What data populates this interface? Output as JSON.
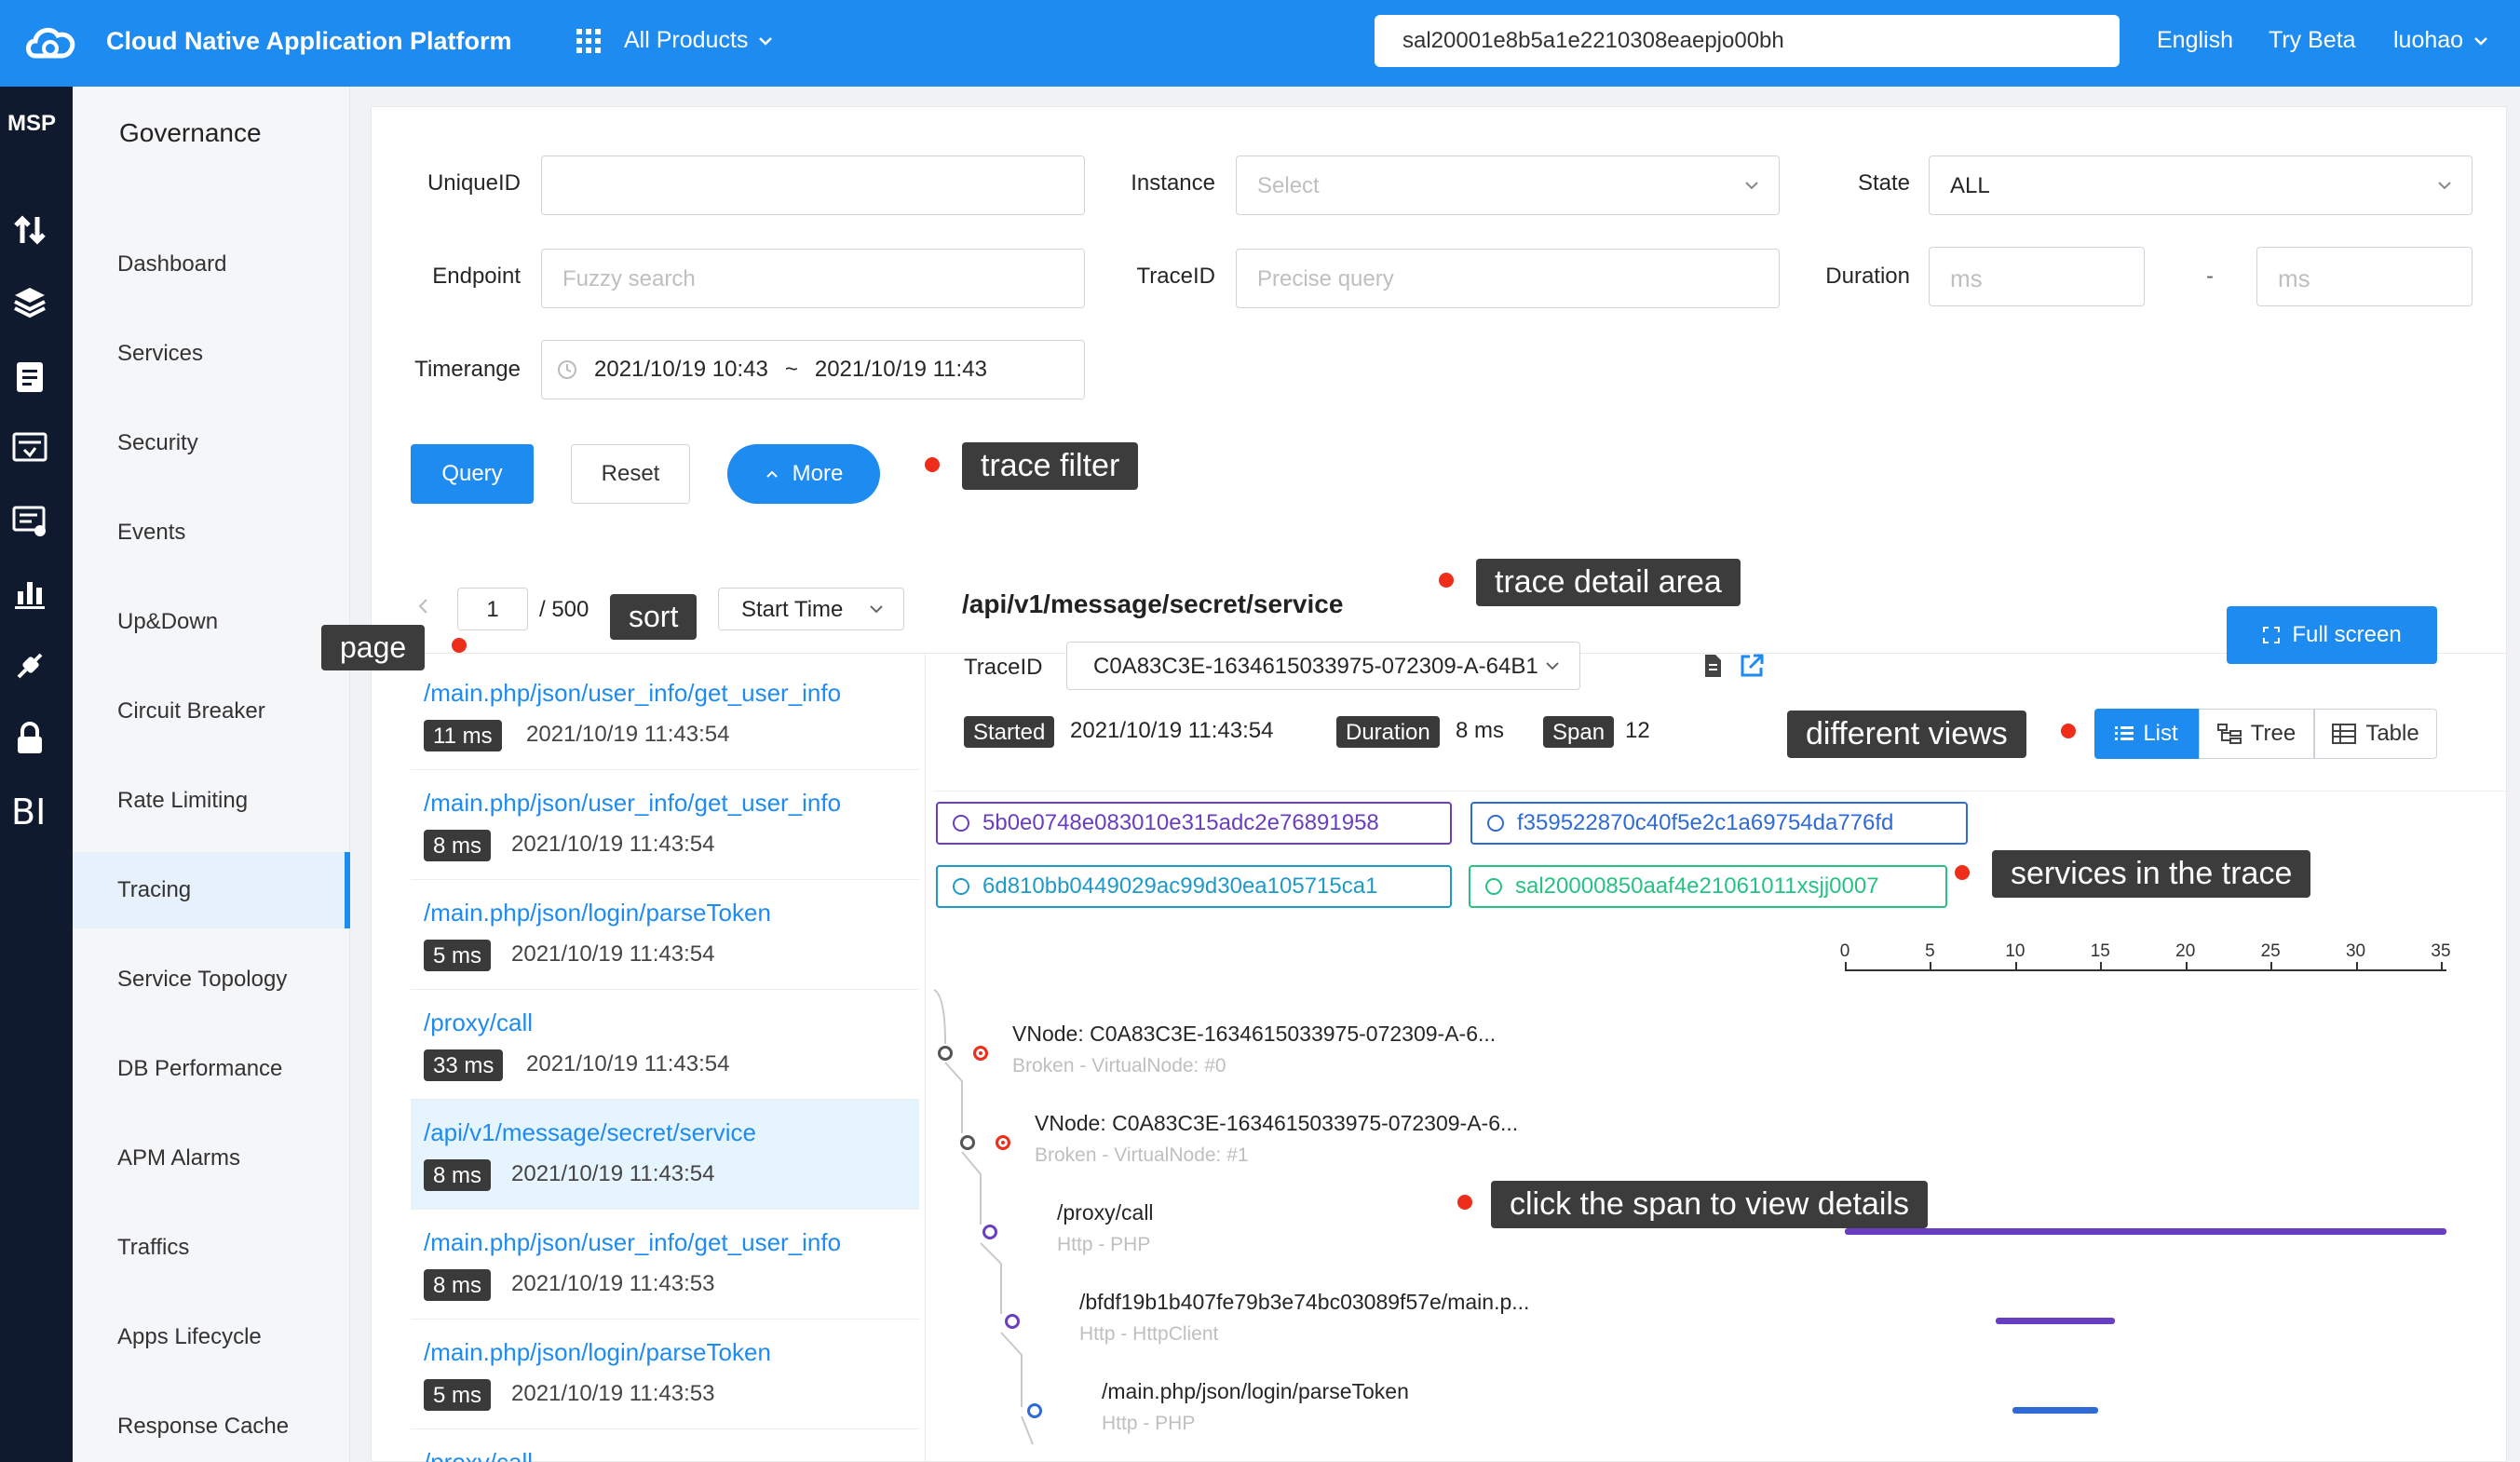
{
  "colors": {
    "primary": "#1e8bf0",
    "rail": "#0f1a2e",
    "annotation_dot": "#ee2d1a",
    "purple": "#6a3ec0",
    "teal_blue": "#1f9ac7",
    "green": "#27c281"
  },
  "topbar": {
    "title": "Cloud Native Application Platform",
    "products_label": "All Products",
    "search_value": "sal20001e8b5a1e2210308eaepjo00bh",
    "language": "English",
    "try_beta": "Try Beta",
    "user": "luohao"
  },
  "rail": {
    "label": "MSP",
    "icons": [
      "transfer-icon",
      "layers-icon",
      "clipboard-icon",
      "monitor-icon",
      "log-icon",
      "bar-chart-icon",
      "plug-icon",
      "lock-icon",
      "bi-icon"
    ]
  },
  "nav": {
    "title": "Governance",
    "items": [
      "Dashboard",
      "Services",
      "Security",
      "Events",
      "Up&Down",
      "Circuit Breaker",
      "Rate Limiting",
      "Tracing",
      "Service Topology",
      "DB Performance",
      "APM Alarms",
      "Traffics",
      "Apps Lifecycle",
      "Response Cache"
    ],
    "active": "Tracing"
  },
  "filter": {
    "unique_id_label": "UniqueID",
    "instance_label": "Instance",
    "instance_placeholder": "Select",
    "state_label": "State",
    "state_value": "ALL",
    "endpoint_label": "Endpoint",
    "endpoint_placeholder": "Fuzzy search",
    "trace_id_label": "TraceID",
    "trace_id_placeholder": "Precise query",
    "duration_label": "Duration",
    "duration_min_placeholder": "ms",
    "duration_sep": "-",
    "duration_max_placeholder": "ms",
    "timerange_label": "Timerange",
    "time_start": "2021/10/19 10:43",
    "time_sep": "~",
    "time_end": "2021/10/19 11:43",
    "query_btn": "Query",
    "reset_btn": "Reset",
    "more_btn": "More"
  },
  "annotations": {
    "trace_filter": "trace filter",
    "trace_detail": "trace detail area",
    "page": "page",
    "sort": "sort",
    "different_views": "different views",
    "services_in_trace": "services in the trace",
    "click_span": "click the span to view details"
  },
  "list": {
    "page_current": "1",
    "page_total": "/ 500",
    "sort_value": "Start Time",
    "items": [
      {
        "path": "/main.php/json/user_info/get_user_info",
        "ms": "11 ms",
        "time": "2021/10/19 11:43:54"
      },
      {
        "path": "/main.php/json/user_info/get_user_info",
        "ms": "8 ms",
        "time": "2021/10/19 11:43:54"
      },
      {
        "path": "/main.php/json/login/parseToken",
        "ms": "5 ms",
        "time": "2021/10/19 11:43:54"
      },
      {
        "path": "/proxy/call",
        "ms": "33 ms",
        "time": "2021/10/19 11:43:54"
      },
      {
        "path": "/api/v1/message/secret/service",
        "ms": "8 ms",
        "time": "2021/10/19 11:43:54"
      },
      {
        "path": "/main.php/json/user_info/get_user_info",
        "ms": "8 ms",
        "time": "2021/10/19 11:43:53"
      },
      {
        "path": "/main.php/json/login/parseToken",
        "ms": "5 ms",
        "time": "2021/10/19 11:43:53"
      },
      {
        "path": "/proxy/call"
      }
    ]
  },
  "detail": {
    "title": "/api/v1/message/secret/service",
    "full_screen": "Full screen",
    "trace_id_label": "TraceID",
    "trace_id_value": "C0A83C3E-1634615033975-072309-A-64B1",
    "started_label": "Started",
    "started_value": "2021/10/19 11:43:54",
    "duration_label": "Duration",
    "duration_value": "8 ms",
    "span_label": "Span",
    "span_value": "12",
    "views": [
      "List",
      "Tree",
      "Table"
    ],
    "services": [
      "5b0e0748e083010e315adc2e76891958",
      "f359522870c40f5e2c1a69754da776fd",
      "6d810bb0449029ac99d30ea105715ca1",
      "sal20000850aaf4e21061011xsjj0007"
    ],
    "ticks": [
      "0",
      "5",
      "10",
      "15",
      "20",
      "25",
      "30",
      "35"
    ],
    "spans": [
      {
        "name": "VNode: C0A83C3E-1634615033975-072309-A-6...",
        "sub": "Broken - VirtualNode: #0"
      },
      {
        "name": "VNode: C0A83C3E-1634615033975-072309-A-6...",
        "sub": "Broken - VirtualNode: #1"
      },
      {
        "name": "/proxy/call",
        "sub": "Http - PHP"
      },
      {
        "name": "/bfdf19b1b407fe79b3e74bc03089f57e/main.p...",
        "sub": "Http - HttpClient"
      },
      {
        "name": "/main.php/json/login/parseToken",
        "sub": "Http - PHP"
      }
    ]
  }
}
